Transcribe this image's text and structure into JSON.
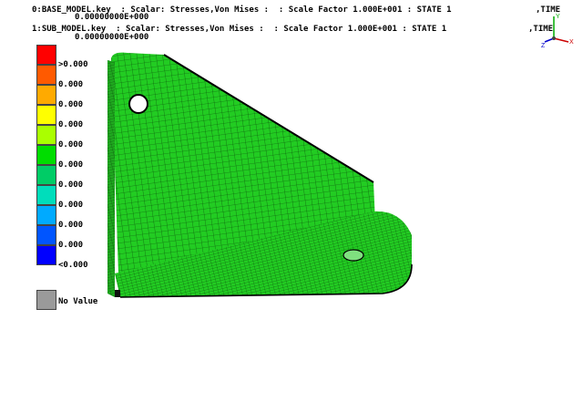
{
  "header": {
    "line1": "0:BASE_MODEL.key  : Scalar: Stresses,Von Mises :  : Scale Factor 1.000E+001 : STATE 1",
    "line1_value": "0.00000000E+000",
    "line2": "1:SUB_MODEL.key  : Scalar: Stresses,Von Mises :  : Scale Factor 1.000E+001 : STATE 1",
    "line2_value": "0.00000000E+000",
    "time1": ",TIME",
    "time2": ",TIME"
  },
  "legend": {
    "labels": [
      ">0.000",
      "0.000",
      "0.000",
      "0.000",
      "0.000",
      "0.000",
      "0.000",
      "0.000",
      "0.000",
      "0.000",
      "<0.000"
    ],
    "colors": [
      "#ff0000",
      "#ff5a00",
      "#ffaa00",
      "#ffff00",
      "#aaff00",
      "#00dd00",
      "#00cc66",
      "#00ddbb",
      "#00aaff",
      "#0055ff",
      "#0000ff"
    ],
    "no_value_label": "No Value",
    "no_value_color": "#9a9a9a"
  },
  "model": {
    "fill_color": "#22cc22",
    "mesh_color": "#000000"
  },
  "triad": {
    "x_label": "X",
    "y_label": "Y",
    "z_label": "Z"
  }
}
